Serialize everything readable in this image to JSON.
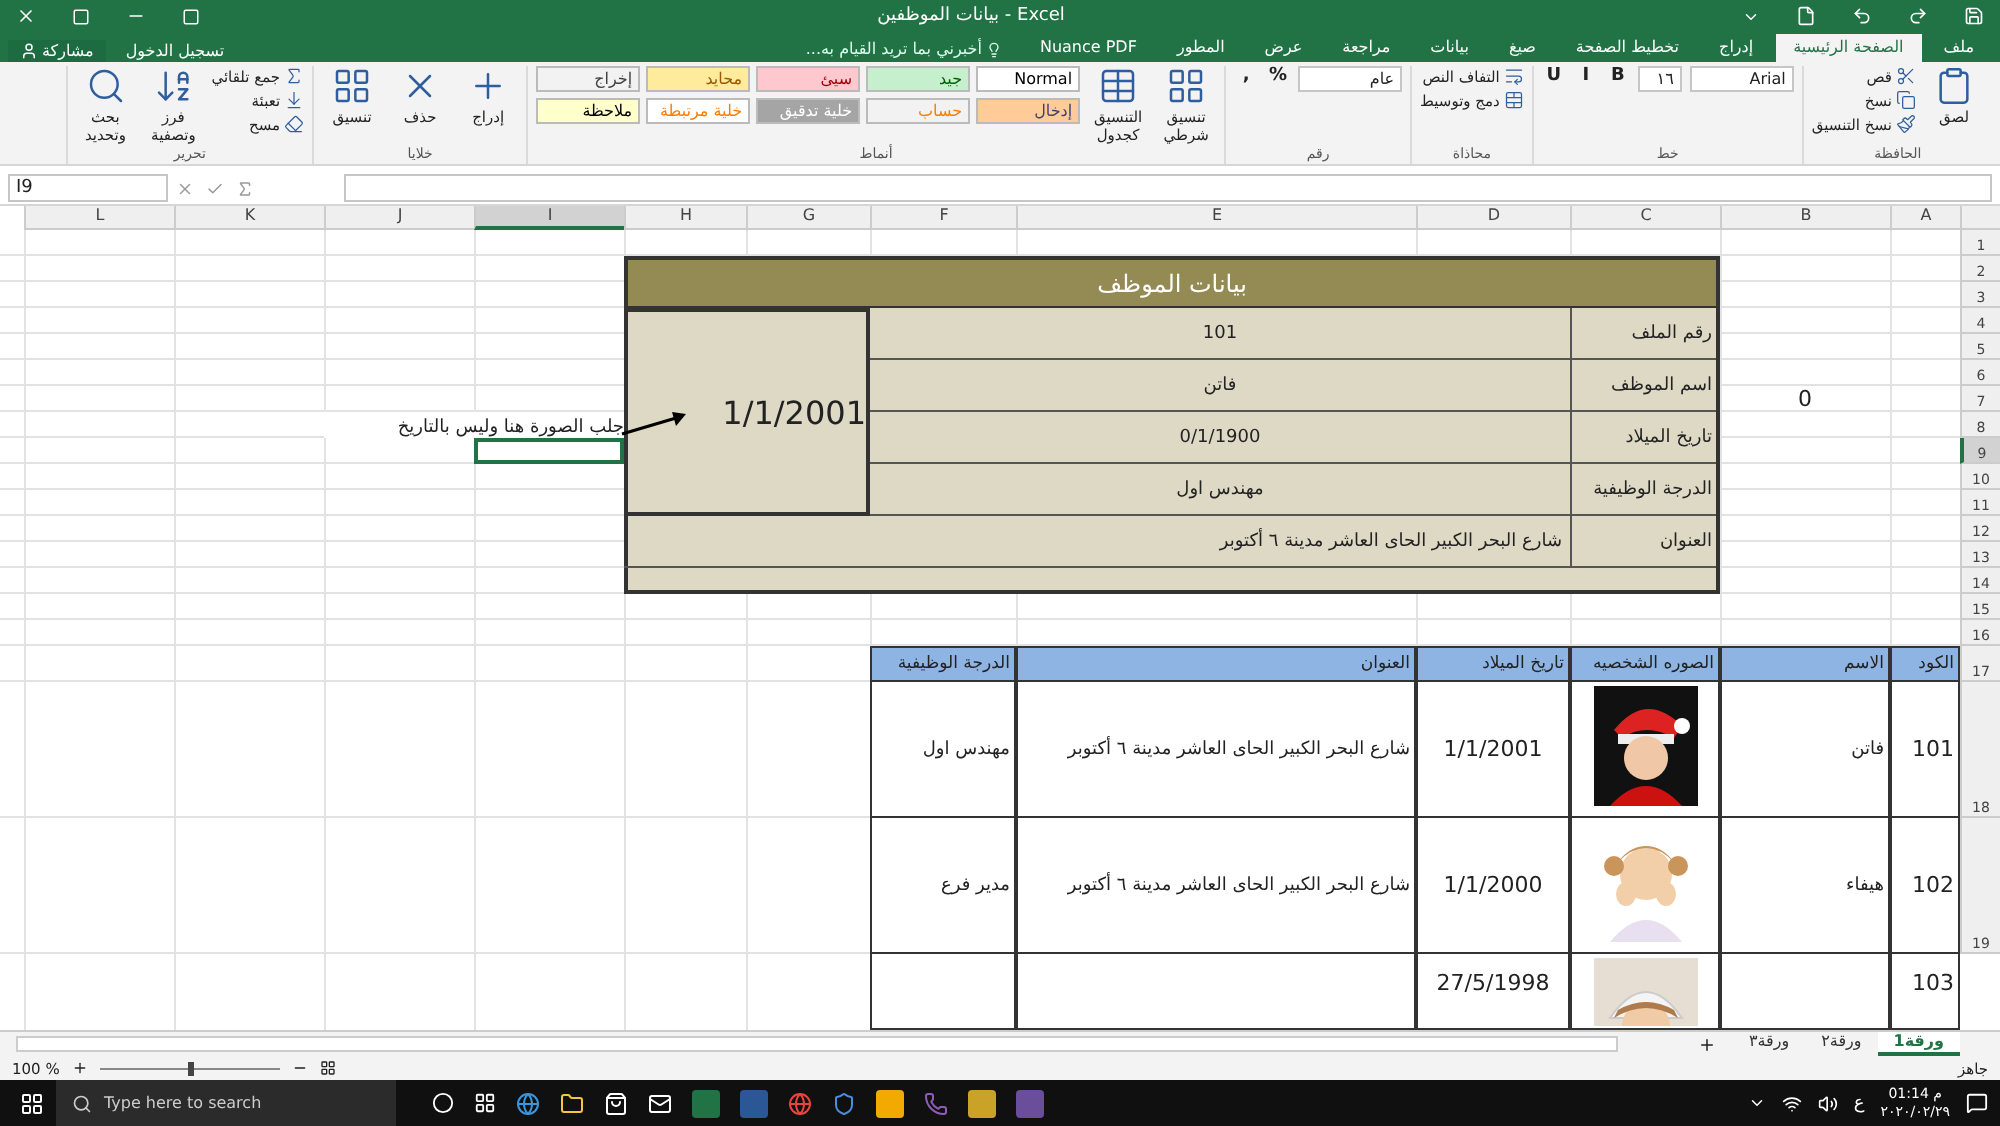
{
  "window": {
    "title": "بيانات الموظفين - Excel"
  },
  "account": {
    "share": "مشاركة",
    "sign_in": "تسجيل الدخول"
  },
  "tabs": [
    {
      "label": "ملف",
      "selected": false
    },
    {
      "label": "الصفحة الرئيسية",
      "selected": true
    },
    {
      "label": "إدراج",
      "selected": false
    },
    {
      "label": "تخطيط الصفحة",
      "selected": false
    },
    {
      "label": "صيغ",
      "selected": false
    },
    {
      "label": "بيانات",
      "selected": false
    },
    {
      "label": "مراجعة",
      "selected": false
    },
    {
      "label": "عرض",
      "selected": false
    },
    {
      "label": "المطور",
      "selected": false
    },
    {
      "label": "Nuance PDF",
      "selected": false
    }
  ],
  "tell_me": "أخبرني بما تريد القيام به...",
  "ribbon": [
    {
      "label": "الحافظة",
      "items": [
        {
          "kind": "large",
          "label": "لصق"
        },
        {
          "kind": "small",
          "label": "قص"
        },
        {
          "kind": "small",
          "label": "نسخ"
        },
        {
          "kind": "small",
          "label": "نسخ التنسيق"
        }
      ]
    },
    {
      "label": "خط",
      "items": [
        {
          "kind": "field",
          "label": "Arial"
        },
        {
          "kind": "field",
          "label": "١٦"
        },
        {
          "kind": "glyph",
          "label": "B"
        },
        {
          "kind": "glyph",
          "label": "I"
        },
        {
          "kind": "glyph",
          "label": "U"
        }
      ]
    },
    {
      "label": "محاذاة",
      "items": [
        {
          "kind": "small",
          "label": "التفاف النص"
        },
        {
          "kind": "small",
          "label": "دمج وتوسيط"
        }
      ]
    },
    {
      "label": "رقم",
      "items": [
        {
          "kind": "field",
          "label": "عام"
        },
        {
          "kind": "glyph",
          "label": "%"
        },
        {
          "kind": "glyph",
          "label": ","
        }
      ]
    },
    {
      "label": "أنماط",
      "items": [
        {
          "kind": "large",
          "label": "تنسيق شرطي"
        },
        {
          "kind": "large",
          "label": "التنسيق كجدول"
        },
        {
          "kind": "styles"
        }
      ]
    },
    {
      "label": "خلايا",
      "items": [
        {
          "kind": "large",
          "label": "إدراج"
        },
        {
          "kind": "large",
          "label": "حذف"
        },
        {
          "kind": "large",
          "label": "تنسيق"
        }
      ]
    },
    {
      "label": "تحرير",
      "items": [
        {
          "kind": "small",
          "label": "جمع تلقائي"
        },
        {
          "kind": "small",
          "label": "تعبئة"
        },
        {
          "kind": "small",
          "label": "مسح"
        },
        {
          "kind": "large",
          "label": "فرز وتصفية"
        },
        {
          "kind": "large",
          "label": "بحث وتحديد"
        }
      ]
    }
  ],
  "cell_styles": [
    {
      "label": "Normal",
      "color": "#ffffff"
    },
    {
      "label": "جيد",
      "color": "#c6efce"
    },
    {
      "label": "سيئ",
      "color": "#ffc7ce"
    },
    {
      "label": "محايد",
      "color": "#ffeb9c"
    },
    {
      "label": "إخراج",
      "color": "#f2f2f2"
    },
    {
      "label": "إدخال",
      "color": "#ffcc99"
    },
    {
      "label": "حساب",
      "color": "#f2f2f2"
    },
    {
      "label": "خلية تدقيق",
      "color": "#a5a5a5"
    },
    {
      "label": "خلية مرتبطة",
      "color": "#ffffff"
    },
    {
      "label": "ملاحظة",
      "color": "#ffffcc"
    }
  ],
  "name_box": "I9",
  "columns": [
    {
      "label": "A",
      "selected": false
    },
    {
      "label": "B",
      "selected": false
    },
    {
      "label": "C",
      "selected": false
    },
    {
      "label": "D",
      "selected": false
    },
    {
      "label": "E",
      "selected": false
    },
    {
      "label": "F",
      "selected": false
    },
    {
      "label": "G",
      "selected": false
    },
    {
      "label": "H",
      "selected": false
    },
    {
      "label": "I",
      "selected": true
    },
    {
      "label": "J",
      "selected": false
    },
    {
      "label": "K",
      "selected": false
    },
    {
      "label": "L",
      "selected": false
    }
  ],
  "rows": [
    {
      "label": "1",
      "selected": false
    },
    {
      "label": "2",
      "selected": false
    },
    {
      "label": "3",
      "selected": false
    },
    {
      "label": "4",
      "selected": false
    },
    {
      "label": "5",
      "selected": false
    },
    {
      "label": "6",
      "selected": false
    },
    {
      "label": "7",
      "selected": false
    },
    {
      "label": "8",
      "selected": false
    },
    {
      "label": "9",
      "selected": true
    },
    {
      "label": "10",
      "selected": false
    },
    {
      "label": "11",
      "selected": false
    },
    {
      "label": "12",
      "selected": false
    },
    {
      "label": "13",
      "selected": false
    },
    {
      "label": "14",
      "selected": false
    },
    {
      "label": "15",
      "selected": false
    },
    {
      "label": "16",
      "selected": false
    },
    {
      "label": "17",
      "selected": false
    },
    {
      "label": "18",
      "selected": false
    },
    {
      "label": "19",
      "selected": false
    }
  ],
  "form": {
    "title": "بيانات الموظف",
    "fields": [
      {
        "label": "رقم الملف",
        "value": "101"
      },
      {
        "label": "اسم الموظف",
        "value": "فاتن"
      },
      {
        "label": "تاريخ الميلاد",
        "value": "0/1/1900"
      },
      {
        "label": "الدرجة الوظيفية",
        "value": "مهندس اول"
      }
    ],
    "address_label": "العنوان",
    "address": "شارع البحر الكبير الحاى العاشر مدينة ٦ أكتوبر",
    "photo_cell": "1/1/2001"
  },
  "stray_value": "0",
  "note": "جلب الصورة هنا وليس بالتاريخ",
  "table": {
    "columns": [
      "الكود",
      "الاسم",
      "الصوره الشخصيه",
      "تاريخ الميلاد",
      "العنوان",
      "الدرجة الوظيفية"
    ],
    "rows": [
      {
        "code": "101",
        "name": "فاتن",
        "birth": "1/1/2001",
        "address": "شارع البحر الكبير الحاى العاشر مدينة ٦ أكتوبر",
        "grade": "مهندس اول"
      },
      {
        "code": "102",
        "name": "هيفاء",
        "birth": "1/1/2000",
        "address": "شارع البحر الكبير الحاى العاشر مدينة ٦ أكتوبر",
        "grade": "مدير فرع"
      },
      {
        "code": "103",
        "birth": "27/5/1998"
      }
    ]
  },
  "sheets": [
    {
      "label": "ورقة1",
      "selected": true
    },
    {
      "label": "ورقة٢",
      "selected": false
    },
    {
      "label": "ورقة٣",
      "selected": false
    }
  ],
  "status": "جاهز",
  "zoom": {
    "label": "100 %",
    "level": 0.5
  },
  "taskbar": {
    "search_placeholder": "Type here to search",
    "time": "01:14 م",
    "date": "٢٠٢٠/٠٢/٢٩",
    "language": "ع"
  }
}
